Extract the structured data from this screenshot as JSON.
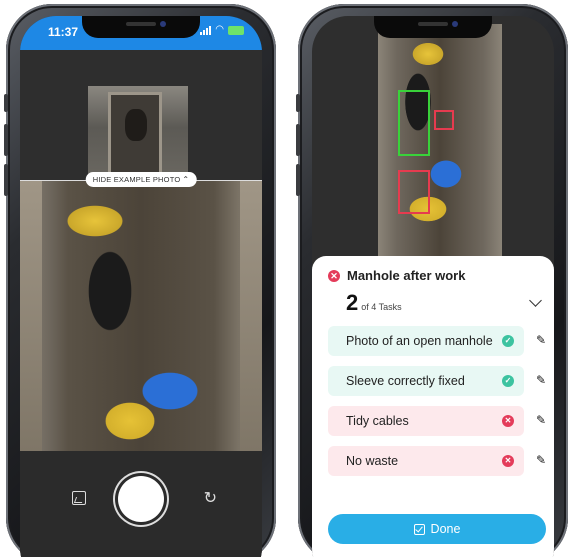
{
  "left_phone": {
    "status": {
      "time": "11:37"
    },
    "hide_example_label": "HIDE EXAMPLE PHOTO",
    "icons": {
      "gallery": "gallery-icon",
      "shutter": "shutter-button",
      "flip": "flip-camera-icon"
    }
  },
  "right_phone": {
    "sheet": {
      "title": "Manhole after work",
      "done_count": "2",
      "of_tasks": "of 4 Tasks",
      "tasks": [
        {
          "label": "Photo of an open manhole",
          "status": "ok"
        },
        {
          "label": "Sleeve correctly fixed",
          "status": "ok"
        },
        {
          "label": "Tidy cables",
          "status": "bad"
        },
        {
          "label": "No waste",
          "status": "bad"
        }
      ],
      "done_label": "Done"
    }
  },
  "colors": {
    "status_bar": "#1e88e5",
    "ok": "#3cc3a0",
    "bad": "#e43b5a",
    "done_button": "#29aee6",
    "box_green": "#39d23a",
    "box_red": "#e63b4f"
  }
}
